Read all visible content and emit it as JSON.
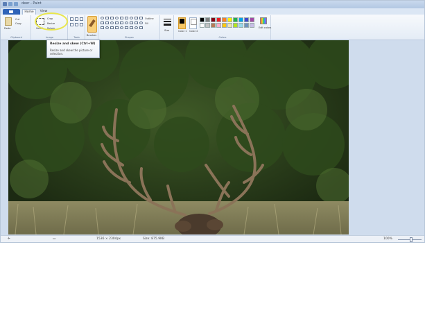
{
  "window": {
    "title": "deer - Paint"
  },
  "tabs": [
    {
      "label": "Home"
    },
    {
      "label": "View"
    }
  ],
  "ribbon": {
    "clipboard": {
      "paste_label": "Paste",
      "cut_label": "Cut",
      "copy_label": "Copy",
      "group_label": "Clipboard"
    },
    "image": {
      "select_label": "Select",
      "crop_label": "Crop",
      "resize_label": "Resize",
      "rotate_label": "Rotate",
      "group_label": "Image"
    },
    "tools": {
      "group_label": "Tools"
    },
    "brushes": {
      "label": "Brushes"
    },
    "shapes": {
      "outline_label": "Outline",
      "fill_label": "Fill",
      "group_label": "Shapes"
    },
    "size": {
      "label": "Size"
    },
    "colors": {
      "color1_label": "Color 1",
      "color2_label": "Color 2",
      "edit_label": "Edit colors",
      "group_label": "Colors",
      "palette_row1": [
        "#000000",
        "#7f7f7f",
        "#880015",
        "#ed1c24",
        "#ff7f27",
        "#fff200",
        "#22b14c",
        "#00a2e8",
        "#3f48cc",
        "#a349a4"
      ],
      "palette_row2": [
        "#ffffff",
        "#c3c3c3",
        "#b97a57",
        "#ffaec9",
        "#ffc90e",
        "#efe4b0",
        "#b5e61d",
        "#99d9ea",
        "#7092be",
        "#c8bfe7"
      ]
    }
  },
  "tooltip": {
    "title": "Resize and skew (Ctrl+W)",
    "body": "Resize and skew the picture or selection."
  },
  "status": {
    "dimensions": "1536 × 2304px",
    "size": "Size: 875.9KB",
    "zoom": "100%"
  }
}
